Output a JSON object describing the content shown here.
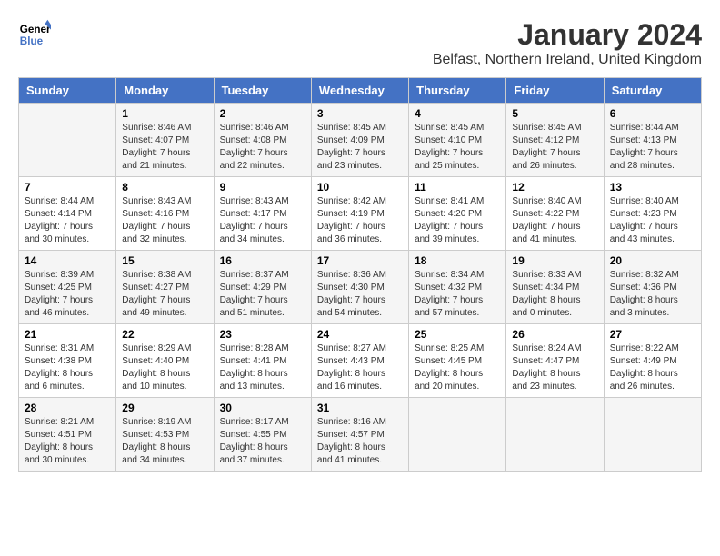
{
  "header": {
    "logo_line1": "General",
    "logo_line2": "Blue",
    "month_year": "January 2024",
    "location": "Belfast, Northern Ireland, United Kingdom"
  },
  "days_of_week": [
    "Sunday",
    "Monday",
    "Tuesday",
    "Wednesday",
    "Thursday",
    "Friday",
    "Saturday"
  ],
  "weeks": [
    [
      {
        "day": "",
        "sunrise": "",
        "sunset": "",
        "daylight": ""
      },
      {
        "day": "1",
        "sunrise": "Sunrise: 8:46 AM",
        "sunset": "Sunset: 4:07 PM",
        "daylight": "Daylight: 7 hours and 21 minutes."
      },
      {
        "day": "2",
        "sunrise": "Sunrise: 8:46 AM",
        "sunset": "Sunset: 4:08 PM",
        "daylight": "Daylight: 7 hours and 22 minutes."
      },
      {
        "day": "3",
        "sunrise": "Sunrise: 8:45 AM",
        "sunset": "Sunset: 4:09 PM",
        "daylight": "Daylight: 7 hours and 23 minutes."
      },
      {
        "day": "4",
        "sunrise": "Sunrise: 8:45 AM",
        "sunset": "Sunset: 4:10 PM",
        "daylight": "Daylight: 7 hours and 25 minutes."
      },
      {
        "day": "5",
        "sunrise": "Sunrise: 8:45 AM",
        "sunset": "Sunset: 4:12 PM",
        "daylight": "Daylight: 7 hours and 26 minutes."
      },
      {
        "day": "6",
        "sunrise": "Sunrise: 8:44 AM",
        "sunset": "Sunset: 4:13 PM",
        "daylight": "Daylight: 7 hours and 28 minutes."
      }
    ],
    [
      {
        "day": "7",
        "sunrise": "Sunrise: 8:44 AM",
        "sunset": "Sunset: 4:14 PM",
        "daylight": "Daylight: 7 hours and 30 minutes."
      },
      {
        "day": "8",
        "sunrise": "Sunrise: 8:43 AM",
        "sunset": "Sunset: 4:16 PM",
        "daylight": "Daylight: 7 hours and 32 minutes."
      },
      {
        "day": "9",
        "sunrise": "Sunrise: 8:43 AM",
        "sunset": "Sunset: 4:17 PM",
        "daylight": "Daylight: 7 hours and 34 minutes."
      },
      {
        "day": "10",
        "sunrise": "Sunrise: 8:42 AM",
        "sunset": "Sunset: 4:19 PM",
        "daylight": "Daylight: 7 hours and 36 minutes."
      },
      {
        "day": "11",
        "sunrise": "Sunrise: 8:41 AM",
        "sunset": "Sunset: 4:20 PM",
        "daylight": "Daylight: 7 hours and 39 minutes."
      },
      {
        "day": "12",
        "sunrise": "Sunrise: 8:40 AM",
        "sunset": "Sunset: 4:22 PM",
        "daylight": "Daylight: 7 hours and 41 minutes."
      },
      {
        "day": "13",
        "sunrise": "Sunrise: 8:40 AM",
        "sunset": "Sunset: 4:23 PM",
        "daylight": "Daylight: 7 hours and 43 minutes."
      }
    ],
    [
      {
        "day": "14",
        "sunrise": "Sunrise: 8:39 AM",
        "sunset": "Sunset: 4:25 PM",
        "daylight": "Daylight: 7 hours and 46 minutes."
      },
      {
        "day": "15",
        "sunrise": "Sunrise: 8:38 AM",
        "sunset": "Sunset: 4:27 PM",
        "daylight": "Daylight: 7 hours and 49 minutes."
      },
      {
        "day": "16",
        "sunrise": "Sunrise: 8:37 AM",
        "sunset": "Sunset: 4:29 PM",
        "daylight": "Daylight: 7 hours and 51 minutes."
      },
      {
        "day": "17",
        "sunrise": "Sunrise: 8:36 AM",
        "sunset": "Sunset: 4:30 PM",
        "daylight": "Daylight: 7 hours and 54 minutes."
      },
      {
        "day": "18",
        "sunrise": "Sunrise: 8:34 AM",
        "sunset": "Sunset: 4:32 PM",
        "daylight": "Daylight: 7 hours and 57 minutes."
      },
      {
        "day": "19",
        "sunrise": "Sunrise: 8:33 AM",
        "sunset": "Sunset: 4:34 PM",
        "daylight": "Daylight: 8 hours and 0 minutes."
      },
      {
        "day": "20",
        "sunrise": "Sunrise: 8:32 AM",
        "sunset": "Sunset: 4:36 PM",
        "daylight": "Daylight: 8 hours and 3 minutes."
      }
    ],
    [
      {
        "day": "21",
        "sunrise": "Sunrise: 8:31 AM",
        "sunset": "Sunset: 4:38 PM",
        "daylight": "Daylight: 8 hours and 6 minutes."
      },
      {
        "day": "22",
        "sunrise": "Sunrise: 8:29 AM",
        "sunset": "Sunset: 4:40 PM",
        "daylight": "Daylight: 8 hours and 10 minutes."
      },
      {
        "day": "23",
        "sunrise": "Sunrise: 8:28 AM",
        "sunset": "Sunset: 4:41 PM",
        "daylight": "Daylight: 8 hours and 13 minutes."
      },
      {
        "day": "24",
        "sunrise": "Sunrise: 8:27 AM",
        "sunset": "Sunset: 4:43 PM",
        "daylight": "Daylight: 8 hours and 16 minutes."
      },
      {
        "day": "25",
        "sunrise": "Sunrise: 8:25 AM",
        "sunset": "Sunset: 4:45 PM",
        "daylight": "Daylight: 8 hours and 20 minutes."
      },
      {
        "day": "26",
        "sunrise": "Sunrise: 8:24 AM",
        "sunset": "Sunset: 4:47 PM",
        "daylight": "Daylight: 8 hours and 23 minutes."
      },
      {
        "day": "27",
        "sunrise": "Sunrise: 8:22 AM",
        "sunset": "Sunset: 4:49 PM",
        "daylight": "Daylight: 8 hours and 26 minutes."
      }
    ],
    [
      {
        "day": "28",
        "sunrise": "Sunrise: 8:21 AM",
        "sunset": "Sunset: 4:51 PM",
        "daylight": "Daylight: 8 hours and 30 minutes."
      },
      {
        "day": "29",
        "sunrise": "Sunrise: 8:19 AM",
        "sunset": "Sunset: 4:53 PM",
        "daylight": "Daylight: 8 hours and 34 minutes."
      },
      {
        "day": "30",
        "sunrise": "Sunrise: 8:17 AM",
        "sunset": "Sunset: 4:55 PM",
        "daylight": "Daylight: 8 hours and 37 minutes."
      },
      {
        "day": "31",
        "sunrise": "Sunrise: 8:16 AM",
        "sunset": "Sunset: 4:57 PM",
        "daylight": "Daylight: 8 hours and 41 minutes."
      },
      {
        "day": "",
        "sunrise": "",
        "sunset": "",
        "daylight": ""
      },
      {
        "day": "",
        "sunrise": "",
        "sunset": "",
        "daylight": ""
      },
      {
        "day": "",
        "sunrise": "",
        "sunset": "",
        "daylight": ""
      }
    ]
  ]
}
